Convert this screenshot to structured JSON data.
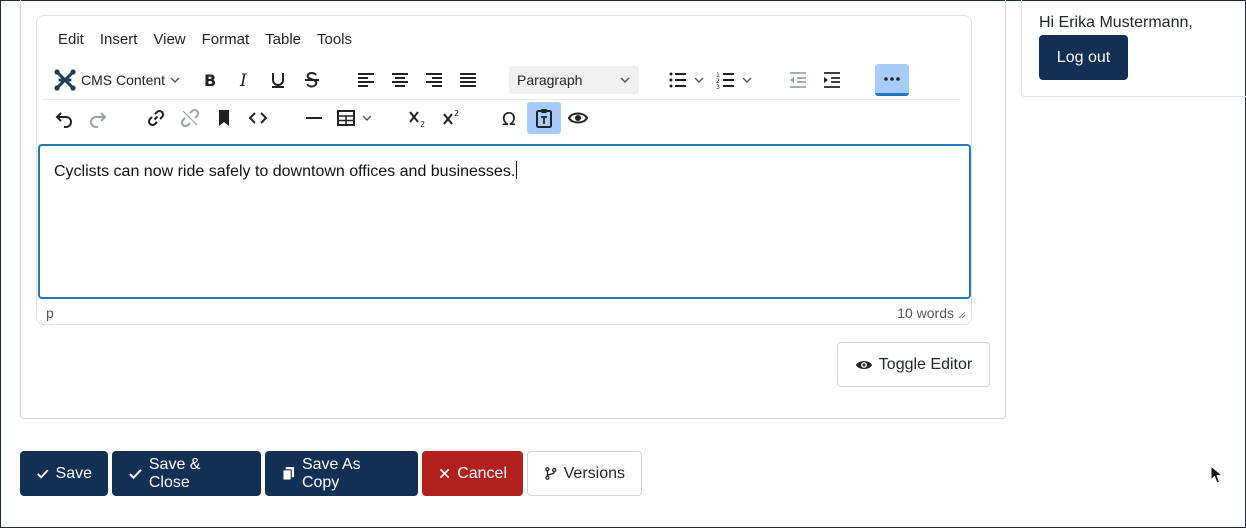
{
  "editor": {
    "menu": [
      "Edit",
      "Insert",
      "View",
      "Format",
      "Table",
      "Tools"
    ],
    "cms_content_label": "CMS Content",
    "block_format": "Paragraph",
    "content_text": "Cyclists can now ride safely to downtown offices and businesses.",
    "status_path": "p",
    "word_count": "10 words",
    "toolbar_row1_icons": [
      "joomla-icon",
      "bold-icon",
      "italic-icon",
      "underline-icon",
      "strikethrough-icon",
      "align-left-icon",
      "align-center-icon",
      "align-right-icon",
      "align-justify-icon",
      "bullet-list-icon",
      "numbered-list-icon",
      "outdent-icon",
      "indent-icon",
      "more-icon"
    ],
    "toolbar_row2_icons": [
      "undo-icon",
      "redo-icon",
      "link-icon",
      "unlink-icon",
      "bookmark-icon",
      "code-icon",
      "horizontal-rule-icon",
      "table-icon",
      "subscript-icon",
      "superscript-icon",
      "omega-icon",
      "paste-text-icon",
      "preview-icon"
    ]
  },
  "toggle_editor_label": "Toggle Editor",
  "user": {
    "greeting": "Hi Erika Mustermann,",
    "logout_label": "Log out"
  },
  "actions": {
    "save": "Save",
    "save_close": "Save & Close",
    "save_copy": "Save As Copy",
    "cancel": "Cancel",
    "versions": "Versions"
  },
  "colors": {
    "primary": "#132f53",
    "danger": "#b2201d",
    "focus": "#207ab7",
    "active_button": "#a6ccf7"
  }
}
